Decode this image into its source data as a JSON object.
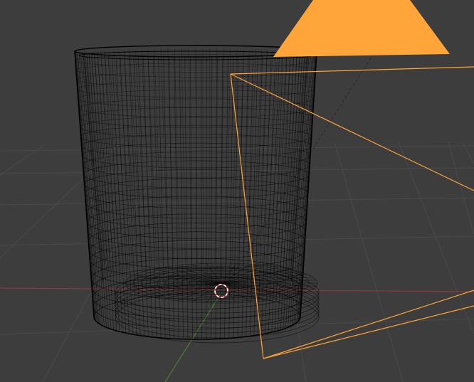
{
  "viewport": {
    "mode": "wireframe",
    "colors": {
      "background": "#3d3d3d",
      "grid": "#4a4a4a",
      "x_axis": "#8a3c3c",
      "y_axis": "#4f7a3a",
      "wireframe": "#000000",
      "camera": "#ffa53a",
      "cursor_red": "#e23a3a",
      "cursor_white": "#ffffff"
    }
  },
  "objects": [
    {
      "name": "glass-mesh",
      "type": "mesh",
      "display": "wireframe"
    },
    {
      "name": "camera",
      "type": "camera",
      "selected": true
    }
  ],
  "cursor": {
    "icon": "3d-cursor-icon"
  }
}
